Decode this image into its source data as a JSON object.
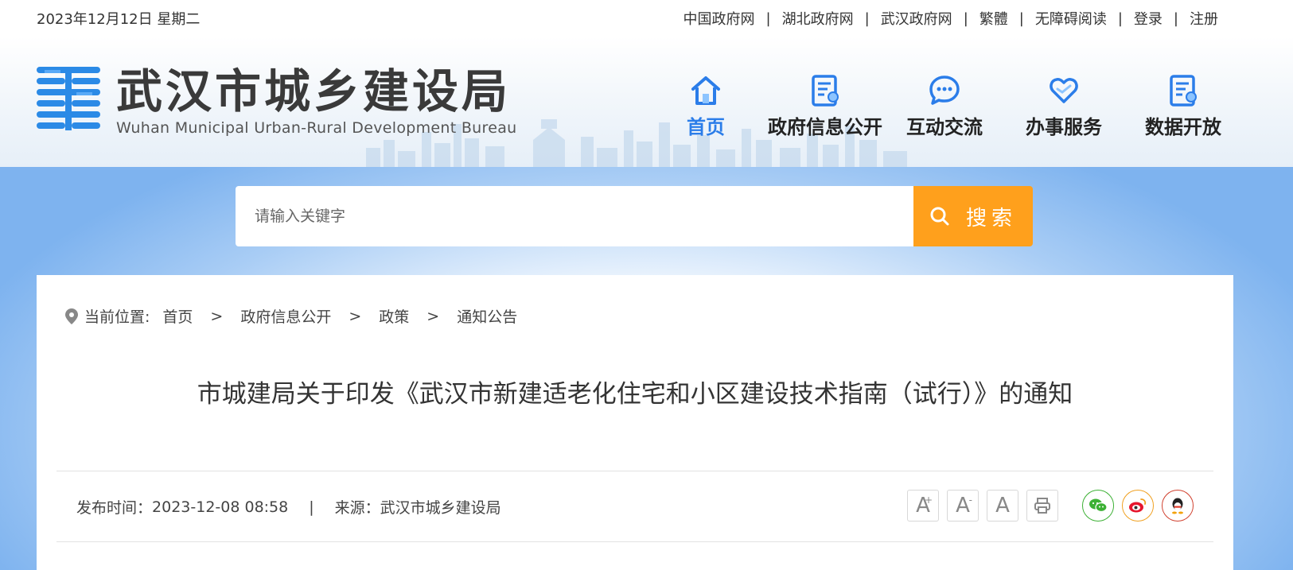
{
  "topbar": {
    "date": "2023年12月12日 星期二",
    "links": [
      "中国政府网",
      "湖北政府网",
      "武汉政府网",
      "繁體",
      "无障碍阅读",
      "登录",
      "注册"
    ],
    "separator": "|"
  },
  "logo": {
    "name_cn": "武汉市城乡建设局",
    "name_en": "Wuhan Municipal Urban-Rural Development Bureau",
    "icon": "bureau-logo-icon"
  },
  "nav": {
    "items": [
      {
        "label": "首页",
        "icon": "home-icon"
      },
      {
        "label": "政府信息公开",
        "icon": "document-icon"
      },
      {
        "label": "互动交流",
        "icon": "chat-icon"
      },
      {
        "label": "办事服务",
        "icon": "heart-hand-icon"
      },
      {
        "label": "数据开放",
        "icon": "data-document-icon"
      }
    ],
    "active": "首页"
  },
  "search": {
    "placeholder": "请输入关键字",
    "button_label": "搜索"
  },
  "breadcrumb": {
    "label": "当前位置:",
    "items": [
      "首页",
      "政府信息公开",
      "政策",
      "通知公告"
    ],
    "separator": ">"
  },
  "article": {
    "title": "市城建局关于印发《武汉市新建适老化住宅和小区建设技术指南（试行）》的通知",
    "publish_label": "发布时间：",
    "publish_time": "2023-12-08 08:58",
    "meta_separator": "|",
    "source_label": "来源：",
    "source": "武汉市城乡建设局"
  },
  "tools": {
    "font_large": "A",
    "font_large_sup": "+",
    "font_small": "A",
    "font_small_sup": "-",
    "font_reset": "A"
  },
  "colors": {
    "accent": "#2b7de9",
    "search_button": "#ffa01c",
    "wechat": "#3cb034",
    "weibo": "#f0a020",
    "qq": "#d0402e"
  }
}
